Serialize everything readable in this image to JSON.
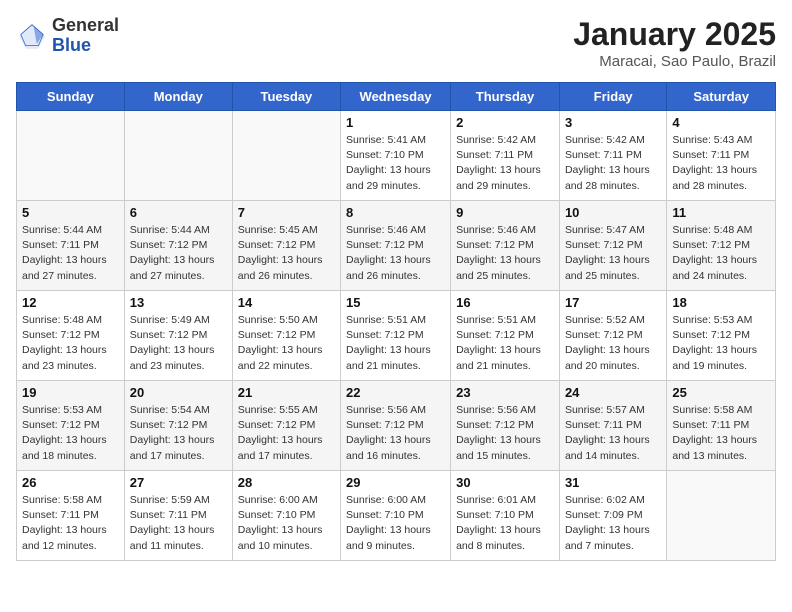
{
  "header": {
    "logo_general": "General",
    "logo_blue": "Blue",
    "title": "January 2025",
    "subtitle": "Maracai, Sao Paulo, Brazil"
  },
  "days_of_week": [
    "Sunday",
    "Monday",
    "Tuesday",
    "Wednesday",
    "Thursday",
    "Friday",
    "Saturday"
  ],
  "weeks": [
    [
      {
        "day": "",
        "info": ""
      },
      {
        "day": "",
        "info": ""
      },
      {
        "day": "",
        "info": ""
      },
      {
        "day": "1",
        "info": "Sunrise: 5:41 AM\nSunset: 7:10 PM\nDaylight: 13 hours\nand 29 minutes."
      },
      {
        "day": "2",
        "info": "Sunrise: 5:42 AM\nSunset: 7:11 PM\nDaylight: 13 hours\nand 29 minutes."
      },
      {
        "day": "3",
        "info": "Sunrise: 5:42 AM\nSunset: 7:11 PM\nDaylight: 13 hours\nand 28 minutes."
      },
      {
        "day": "4",
        "info": "Sunrise: 5:43 AM\nSunset: 7:11 PM\nDaylight: 13 hours\nand 28 minutes."
      }
    ],
    [
      {
        "day": "5",
        "info": "Sunrise: 5:44 AM\nSunset: 7:11 PM\nDaylight: 13 hours\nand 27 minutes."
      },
      {
        "day": "6",
        "info": "Sunrise: 5:44 AM\nSunset: 7:12 PM\nDaylight: 13 hours\nand 27 minutes."
      },
      {
        "day": "7",
        "info": "Sunrise: 5:45 AM\nSunset: 7:12 PM\nDaylight: 13 hours\nand 26 minutes."
      },
      {
        "day": "8",
        "info": "Sunrise: 5:46 AM\nSunset: 7:12 PM\nDaylight: 13 hours\nand 26 minutes."
      },
      {
        "day": "9",
        "info": "Sunrise: 5:46 AM\nSunset: 7:12 PM\nDaylight: 13 hours\nand 25 minutes."
      },
      {
        "day": "10",
        "info": "Sunrise: 5:47 AM\nSunset: 7:12 PM\nDaylight: 13 hours\nand 25 minutes."
      },
      {
        "day": "11",
        "info": "Sunrise: 5:48 AM\nSunset: 7:12 PM\nDaylight: 13 hours\nand 24 minutes."
      }
    ],
    [
      {
        "day": "12",
        "info": "Sunrise: 5:48 AM\nSunset: 7:12 PM\nDaylight: 13 hours\nand 23 minutes."
      },
      {
        "day": "13",
        "info": "Sunrise: 5:49 AM\nSunset: 7:12 PM\nDaylight: 13 hours\nand 23 minutes."
      },
      {
        "day": "14",
        "info": "Sunrise: 5:50 AM\nSunset: 7:12 PM\nDaylight: 13 hours\nand 22 minutes."
      },
      {
        "day": "15",
        "info": "Sunrise: 5:51 AM\nSunset: 7:12 PM\nDaylight: 13 hours\nand 21 minutes."
      },
      {
        "day": "16",
        "info": "Sunrise: 5:51 AM\nSunset: 7:12 PM\nDaylight: 13 hours\nand 21 minutes."
      },
      {
        "day": "17",
        "info": "Sunrise: 5:52 AM\nSunset: 7:12 PM\nDaylight: 13 hours\nand 20 minutes."
      },
      {
        "day": "18",
        "info": "Sunrise: 5:53 AM\nSunset: 7:12 PM\nDaylight: 13 hours\nand 19 minutes."
      }
    ],
    [
      {
        "day": "19",
        "info": "Sunrise: 5:53 AM\nSunset: 7:12 PM\nDaylight: 13 hours\nand 18 minutes."
      },
      {
        "day": "20",
        "info": "Sunrise: 5:54 AM\nSunset: 7:12 PM\nDaylight: 13 hours\nand 17 minutes."
      },
      {
        "day": "21",
        "info": "Sunrise: 5:55 AM\nSunset: 7:12 PM\nDaylight: 13 hours\nand 17 minutes."
      },
      {
        "day": "22",
        "info": "Sunrise: 5:56 AM\nSunset: 7:12 PM\nDaylight: 13 hours\nand 16 minutes."
      },
      {
        "day": "23",
        "info": "Sunrise: 5:56 AM\nSunset: 7:12 PM\nDaylight: 13 hours\nand 15 minutes."
      },
      {
        "day": "24",
        "info": "Sunrise: 5:57 AM\nSunset: 7:11 PM\nDaylight: 13 hours\nand 14 minutes."
      },
      {
        "day": "25",
        "info": "Sunrise: 5:58 AM\nSunset: 7:11 PM\nDaylight: 13 hours\nand 13 minutes."
      }
    ],
    [
      {
        "day": "26",
        "info": "Sunrise: 5:58 AM\nSunset: 7:11 PM\nDaylight: 13 hours\nand 12 minutes."
      },
      {
        "day": "27",
        "info": "Sunrise: 5:59 AM\nSunset: 7:11 PM\nDaylight: 13 hours\nand 11 minutes."
      },
      {
        "day": "28",
        "info": "Sunrise: 6:00 AM\nSunset: 7:10 PM\nDaylight: 13 hours\nand 10 minutes."
      },
      {
        "day": "29",
        "info": "Sunrise: 6:00 AM\nSunset: 7:10 PM\nDaylight: 13 hours\nand 9 minutes."
      },
      {
        "day": "30",
        "info": "Sunrise: 6:01 AM\nSunset: 7:10 PM\nDaylight: 13 hours\nand 8 minutes."
      },
      {
        "day": "31",
        "info": "Sunrise: 6:02 AM\nSunset: 7:09 PM\nDaylight: 13 hours\nand 7 minutes."
      },
      {
        "day": "",
        "info": ""
      }
    ]
  ]
}
